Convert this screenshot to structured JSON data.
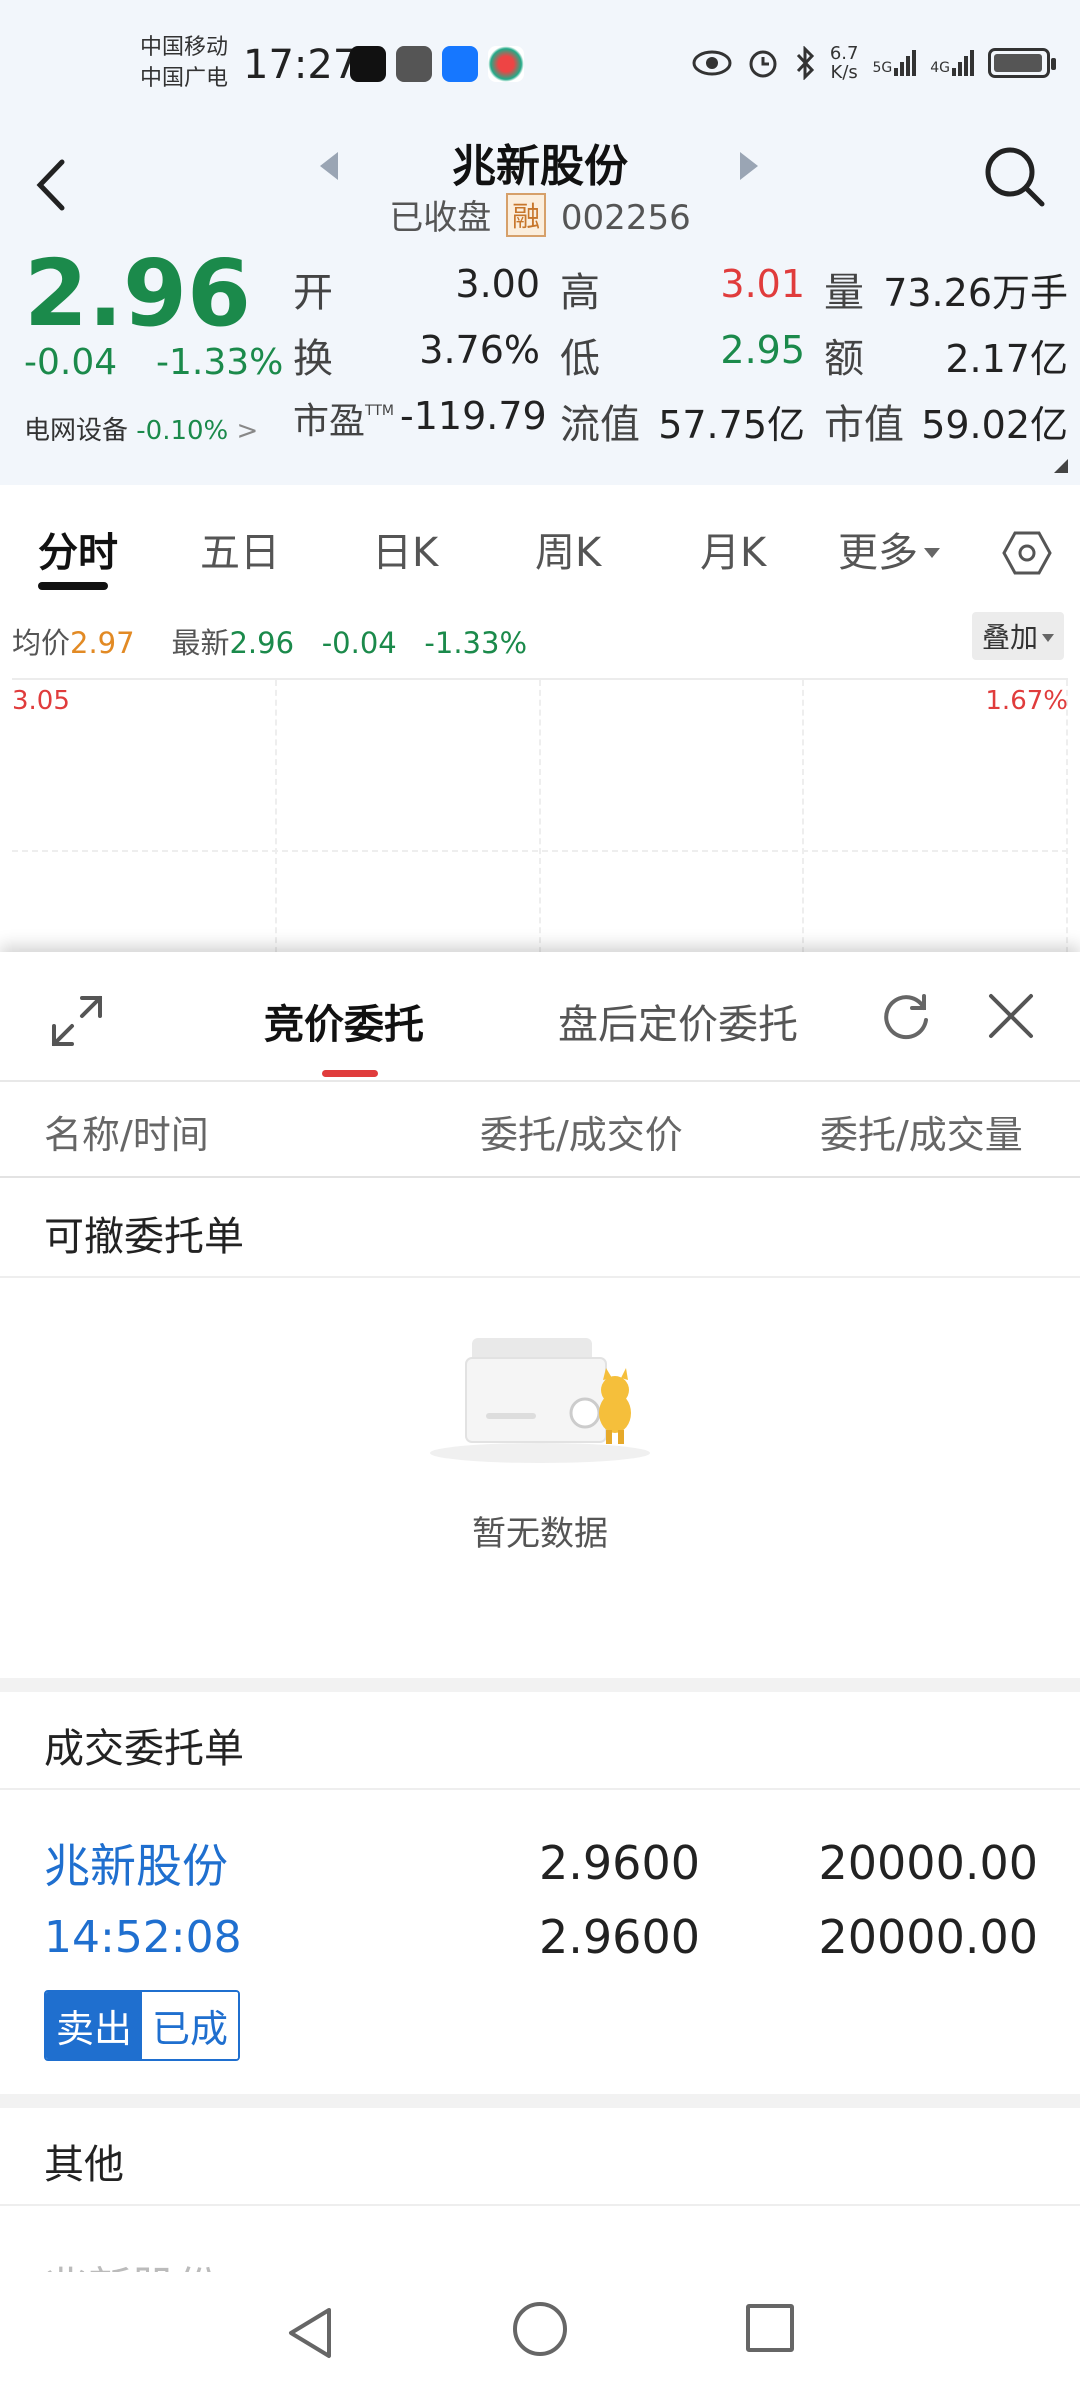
{
  "statusbar": {
    "carrier1": "中国移动",
    "carrier2": "中国广电",
    "time": "17:27",
    "netspeed_value": "6.7",
    "netspeed_unit": "K/s",
    "signal1": "5G",
    "signal2": "4G"
  },
  "header": {
    "stock_name": "兆新股份",
    "status": "已收盘",
    "margin_tag": "融",
    "code": "002256"
  },
  "quote": {
    "price": "2.96",
    "change": "-0.04",
    "change_pct": "-1.33%",
    "sector": "电网设备",
    "sector_pct": "-0.10%",
    "open_label": "开",
    "open": "3.00",
    "high_label": "高",
    "high": "3.01",
    "volume_label": "量",
    "volume": "73.26万手",
    "turnover_label": "换",
    "turnover": "3.76%",
    "low_label": "低",
    "low": "2.95",
    "amount_label": "额",
    "amount": "2.17亿",
    "pe_label": "市盈",
    "pe_sup": "TTM",
    "pe": "-119.79",
    "float_cap_label": "流值",
    "float_cap": "57.75亿",
    "market_cap_label": "市值",
    "market_cap": "59.02亿"
  },
  "tabs": {
    "items": [
      "分时",
      "五日",
      "日K",
      "周K",
      "月K",
      "更多"
    ]
  },
  "intraday": {
    "avg_label": "均价",
    "avg": "2.97",
    "latest_label": "最新",
    "latest": "2.96",
    "change": "-0.04",
    "change_pct": "-1.33%",
    "overlay": "叠加",
    "y_top": "3.05",
    "y_top_pct": "1.67%"
  },
  "sheet": {
    "tab_active": "竞价委托",
    "tab_other": "盘后定价委托",
    "col_name": "名称/时间",
    "col_price": "委托/成交价",
    "col_qty": "委托/成交量",
    "cancelable_title": "可撤委托单",
    "empty_text": "暂无数据",
    "filled_title": "成交委托单",
    "filled": {
      "name": "兆新股份",
      "time": "14:52:08",
      "order_price": "2.9600",
      "deal_price": "2.9600",
      "order_qty": "20000.00",
      "deal_qty": "20000.00",
      "side": "卖出",
      "state": "已成"
    },
    "other_title": "其他",
    "other_row_name": "兆新股份"
  },
  "colors": {
    "up": "#e03c3c",
    "down": "#1b8a4b",
    "link": "#1f6fcf",
    "accent_orange": "#e28a24"
  }
}
